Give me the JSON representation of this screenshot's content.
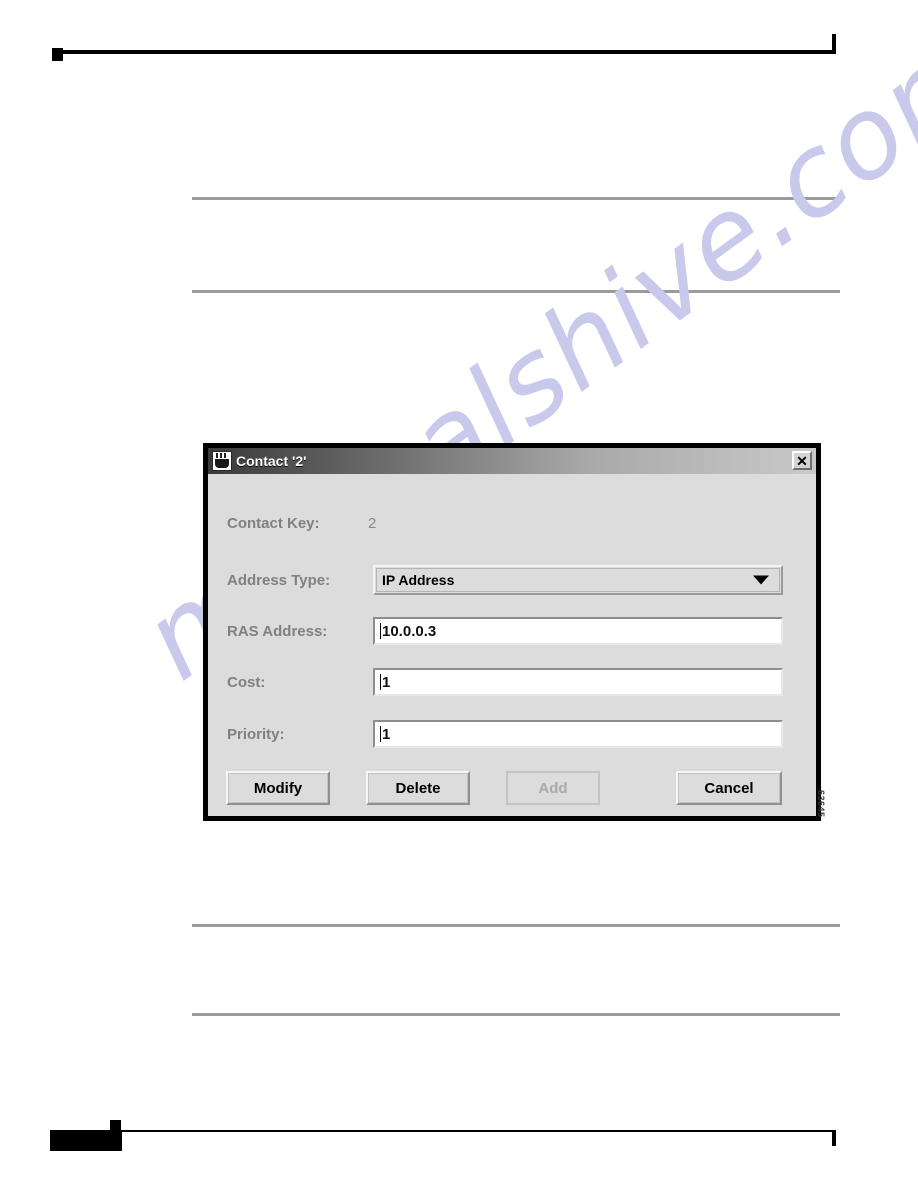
{
  "page": {
    "figure_id": "63645"
  },
  "watermark": {
    "text": "manualshive.com"
  },
  "dialog": {
    "title": "Contact '2'",
    "title_icon": "java-coffee-cup-icon",
    "close_label": "✕",
    "fields": {
      "contact_key": {
        "label": "Contact Key:",
        "value": "2"
      },
      "address_type": {
        "label": "Address Type:",
        "value": "IP Address",
        "options": [
          "IP Address"
        ]
      },
      "ras_address": {
        "label": "RAS Address:",
        "value": "10.0.0.3"
      },
      "cost": {
        "label": "Cost:",
        "value": "1"
      },
      "priority": {
        "label": "Priority:",
        "value": "1"
      }
    },
    "buttons": {
      "modify": "Modify",
      "delete": "Delete",
      "add": "Add",
      "cancel": "Cancel"
    },
    "colors": {
      "panel": "#dcdcdc",
      "label": "#808080",
      "titlebar_dark": "#3a3a3a",
      "titlebar_light": "#c9c9c9",
      "watermark": "#c9c9ec"
    }
  }
}
